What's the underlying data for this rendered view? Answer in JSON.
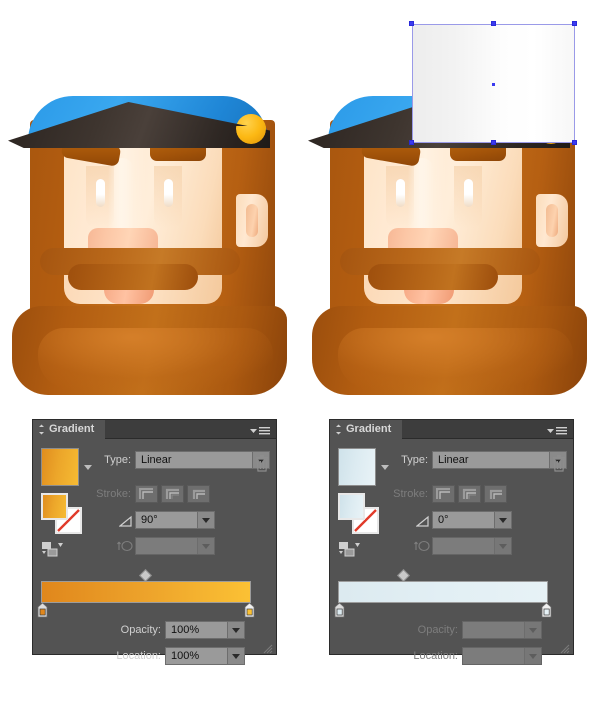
{
  "artwork": {
    "left_label": "bearded-character-illustration",
    "right_label": "bearded-character-illustration-with-selected-rectangle",
    "selection": {
      "shape": "rectangle",
      "fill_description": "white to light gray linear gradient",
      "handle_color": "#3a3af0",
      "border_color": "#9a9ae8"
    },
    "colors": {
      "cap_blue": "#2b9ae8",
      "cap_brim_dark": "#3e352f",
      "cap_button_orange": "#fcb813",
      "beard_brown": "#b35d10",
      "skin": "#ffe9d2",
      "nose_pink": "#fcc7a6",
      "nostril_dark": "#4a2208"
    }
  },
  "panels": [
    {
      "id": "gradient-panel-orange",
      "title": "Gradient",
      "swatch_colors": [
        "#e08d1f",
        "#f6bb33"
      ],
      "type": {
        "label": "Type:",
        "value": "Linear",
        "disabled": false
      },
      "stroke": {
        "label": "Stroke:",
        "disabled": true,
        "buttons": [
          "stroke-within",
          "stroke-centered",
          "stroke-along"
        ]
      },
      "angle": {
        "value": "90°",
        "disabled": false
      },
      "reverse_stops": {
        "value": "",
        "disabled": true
      },
      "gradient_bar": {
        "start_color": "#e0871c",
        "end_color": "#fbc134",
        "midpoint_percent": 50,
        "stops": [
          {
            "position": 0,
            "color": "#e0871c"
          },
          {
            "position": 100,
            "color": "#fbc134"
          }
        ]
      },
      "opacity": {
        "label": "Opacity:",
        "value": "100%",
        "disabled": false
      },
      "location": {
        "label": "Location:",
        "value": "100%",
        "disabled": false
      },
      "delete_stop": "trash-icon"
    },
    {
      "id": "gradient-panel-blue",
      "title": "Gradient",
      "swatch_colors": [
        "#cfe2ea",
        "#e9f3f7"
      ],
      "type": {
        "label": "Type:",
        "value": "Linear",
        "disabled": false
      },
      "stroke": {
        "label": "Stroke:",
        "disabled": true,
        "buttons": [
          "stroke-within",
          "stroke-centered",
          "stroke-along"
        ]
      },
      "angle": {
        "value": "0°",
        "disabled": false
      },
      "reverse_stops": {
        "value": "",
        "disabled": true
      },
      "gradient_bar": {
        "start_color": "#dceaf0",
        "end_color": "#e7f2f6",
        "midpoint_percent": 29,
        "stops": [
          {
            "position": 0,
            "color": "#dceaf0"
          },
          {
            "position": 100,
            "color": "#e7f2f6"
          }
        ]
      },
      "opacity": {
        "label": "Opacity:",
        "value": "",
        "disabled": true
      },
      "location": {
        "label": "Location:",
        "value": "",
        "disabled": true
      },
      "delete_stop": "trash-icon"
    }
  ]
}
